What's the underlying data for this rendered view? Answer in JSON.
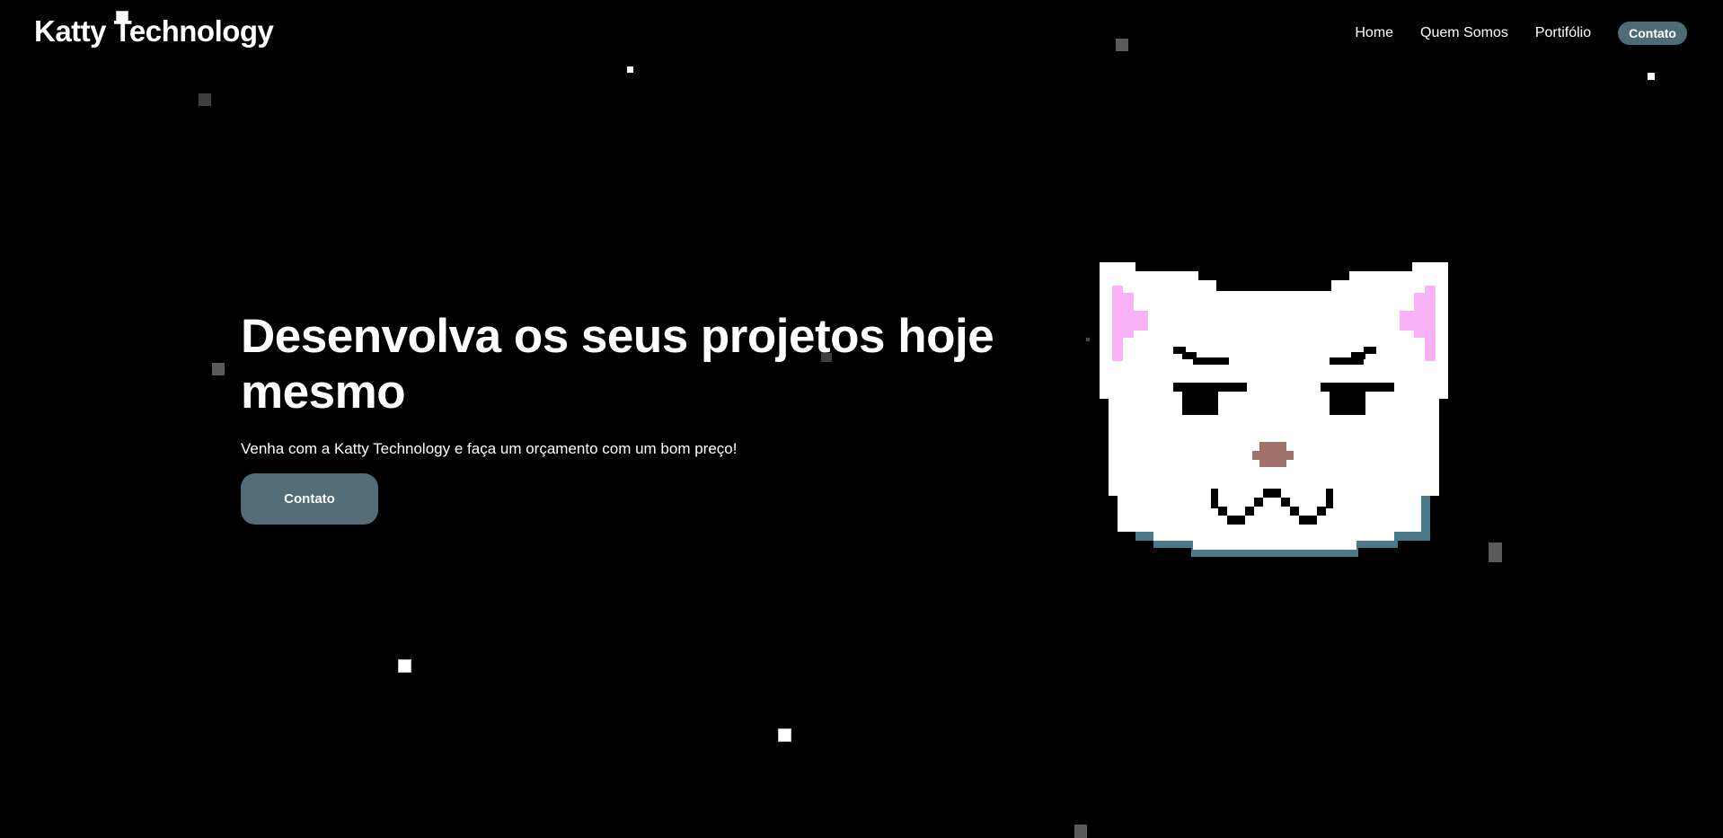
{
  "header": {
    "logo": "Katty Technology",
    "nav": [
      {
        "label": "Home"
      },
      {
        "label": "Quem Somos"
      },
      {
        "label": "Portifólio"
      },
      {
        "label": "Contato"
      }
    ]
  },
  "hero": {
    "title": "Desenvolva os seus projetos hoje mesmo",
    "subtitle": "Venha com a Katty Technology e faça um orçamento com um bom preço!",
    "button_label": "Contato"
  },
  "colors": {
    "background": "#000000",
    "accent": "#526d78",
    "cat_shadow": "#4a7a8a",
    "cat_ear": "#f8b2f5",
    "cat_nose": "#a0726b"
  },
  "icons": {
    "hero_image": "pixel-cat-icon",
    "background": "pixel-star-particles"
  }
}
